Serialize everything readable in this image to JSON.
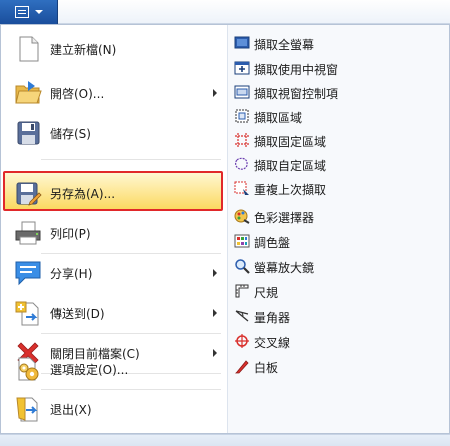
{
  "app_button": {
    "icon": "menu-icon"
  },
  "left_menu": [
    {
      "label": "建立新檔(N)",
      "icon": "new-file-icon",
      "submenu": false
    },
    {
      "label": "開啓(O)...",
      "icon": "open-folder-icon",
      "submenu": true
    },
    {
      "label": "儲存(S)",
      "icon": "save-icon",
      "submenu": false
    },
    {
      "label": "另存為(A)...",
      "icon": "save-as-icon",
      "submenu": false,
      "highlighted": true
    },
    {
      "label": "列印(P)",
      "icon": "printer-icon",
      "submenu": false
    },
    {
      "label": "分享(H)",
      "icon": "share-icon",
      "submenu": true
    },
    {
      "label": "傳送到(D)",
      "icon": "send-to-icon",
      "submenu": true
    },
    {
      "label": "關閉目前檔案(C)",
      "icon": "close-x-icon",
      "submenu": true
    },
    {
      "label": "選項設定(O)...",
      "icon": "settings-icon",
      "submenu": false
    },
    {
      "label": "退出(X)",
      "icon": "exit-icon",
      "submenu": false
    }
  ],
  "right_menu": [
    {
      "label": "擷取全螢幕",
      "icon": "fullscreen-capture-icon"
    },
    {
      "label": "擷取使用中視窗",
      "icon": "active-window-capture-icon"
    },
    {
      "label": "擷取視窗控制項",
      "icon": "window-control-capture-icon"
    },
    {
      "label": "擷取區域",
      "icon": "region-capture-icon"
    },
    {
      "label": "擷取固定區域",
      "icon": "fixed-region-capture-icon"
    },
    {
      "label": "擷取自定區域",
      "icon": "freehand-region-capture-icon"
    },
    {
      "label": "重複上次擷取",
      "icon": "repeat-capture-icon"
    },
    {
      "label": "色彩選擇器",
      "icon": "color-picker-icon"
    },
    {
      "label": "調色盤",
      "icon": "palette-icon"
    },
    {
      "label": "螢幕放大鏡",
      "icon": "magnifier-icon"
    },
    {
      "label": "尺規",
      "icon": "ruler-icon"
    },
    {
      "label": "量角器",
      "icon": "protractor-icon"
    },
    {
      "label": "交叉線",
      "icon": "crosshair-icon"
    },
    {
      "label": "白板",
      "icon": "whiteboard-icon"
    }
  ],
  "colors": {
    "highlight_border": "#e1282a",
    "highlight_fill": "#fde794",
    "app_button": "#1a4e9c"
  }
}
